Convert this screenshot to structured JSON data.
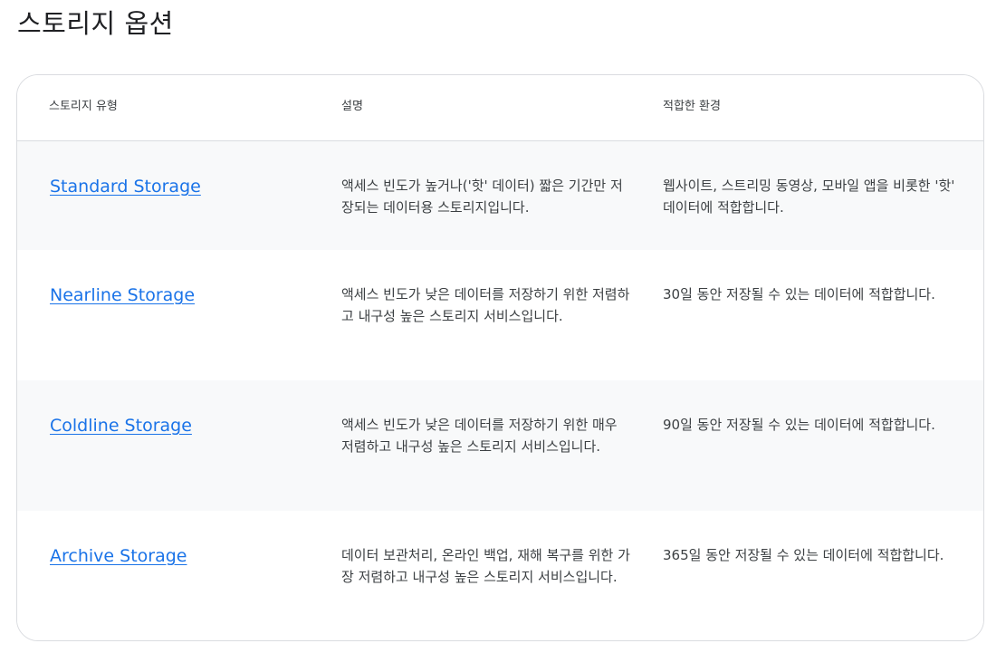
{
  "page": {
    "title": "스토리지 옵션"
  },
  "table": {
    "headers": {
      "type": "스토리지 유형",
      "description": "설명",
      "suitable": "적합한 환경"
    },
    "rows": [
      {
        "name": "Standard Storage",
        "description": "액세스 빈도가 높거나('핫' 데이터) 짧은 기간만 저장되는 데이터용 스토리지입니다.",
        "suitable": "웹사이트, 스트리밍 동영상, 모바일 앱을 비롯한 '핫' 데이터에 적합합니다."
      },
      {
        "name": "Nearline Storage",
        "description": "액세스 빈도가 낮은 데이터를 저장하기 위한 저렴하고 내구성 높은 스토리지 서비스입니다.",
        "suitable": "30일 동안 저장될 수 있는 데이터에 적합합니다."
      },
      {
        "name": "Coldline Storage",
        "description": "액세스 빈도가 낮은 데이터를 저장하기 위한 매우 저렴하고 내구성 높은 스토리지 서비스입니다.",
        "suitable": "90일 동안 저장될 수 있는 데이터에 적합합니다."
      },
      {
        "name": "Archive Storage",
        "description": "데이터 보관처리, 온라인 백업, 재해 복구를 위한 가장 저렴하고 내구성 높은 스토리지 서비스입니다.",
        "suitable": "365일 동안 저장될 수 있는 데이터에 적합합니다."
      }
    ]
  },
  "colors": {
    "link": "#1a73e8",
    "shaded_row": "#f8f9fa",
    "border": "#dadce0",
    "text": "#3c4043"
  }
}
